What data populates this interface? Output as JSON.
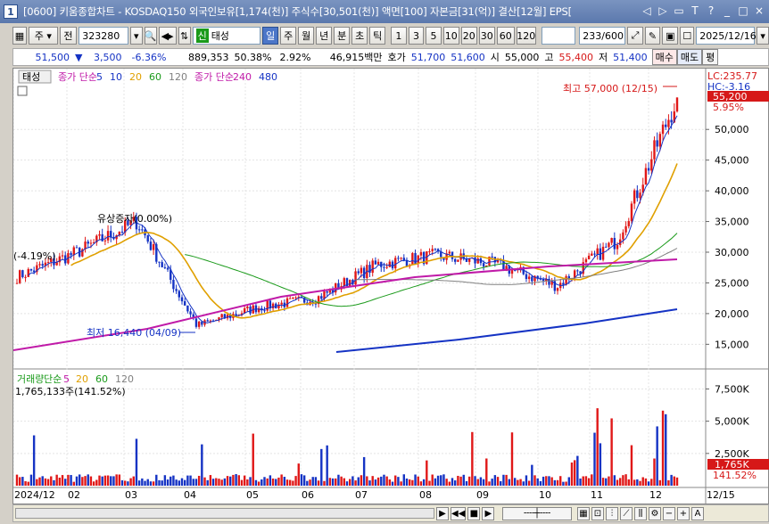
{
  "window": {
    "icon_label": "1",
    "title": "[0600] 키움종합차트 - KOSDAQ150 외국인보유[1,174(천)] 주식수[30,501(천)] 액면[100] 자본금[31(억)] 결산[12월] EPS[",
    "controls": [
      "◁",
      "▷",
      "▭",
      "T",
      "?",
      "_",
      "□",
      "×"
    ]
  },
  "toolbar": {
    "mode": "주",
    "prev_label": "전",
    "code": "323280",
    "stock_badge": "신",
    "stock_name": "태성",
    "periods": [
      "일",
      "주",
      "월",
      "년",
      "분",
      "초",
      "틱"
    ],
    "selected_period": "일",
    "intervals": [
      "1",
      "3",
      "5",
      "10",
      "20",
      "30",
      "60",
      "120"
    ],
    "count": "233",
    "count_total": "/600",
    "date": "2025/12/16"
  },
  "quote": {
    "price": "51,500",
    "change": "3,500",
    "change_pct": "-6.36%",
    "volume": "889,353",
    "vol_ratio": "50.38%",
    "turnover": "2.92%",
    "amount": "46,915백만",
    "ask_label": "호가",
    "ask": "51,700",
    "bid": "51,600",
    "open_label": "시",
    "open": "55,000",
    "high_label": "고",
    "high": "55,400",
    "low_label": "저",
    "low": "51,400",
    "buy_label": "매수",
    "sell_label": "매도",
    "eval_label": "평"
  },
  "price_panel": {
    "tab": "태성",
    "legend": [
      {
        "text": "종가 단순",
        "color": "#c01aa8"
      },
      {
        "text": "5",
        "color": "#1533c4"
      },
      {
        "text": "10",
        "color": "#1533c4"
      },
      {
        "text": "20",
        "color": "#e0a000"
      },
      {
        "text": "60",
        "color": "#1a9a1a"
      },
      {
        "text": "120",
        "color": "#808080"
      },
      {
        "text": "종가 단순",
        "color": "#c01aa8"
      },
      {
        "text": "240",
        "color": "#c01aa8"
      },
      {
        "text": "480",
        "color": "#1533c4"
      }
    ],
    "lc": "LC:235.77",
    "hc": "HC:-3.16",
    "current": "55,200",
    "current_pct": "5.95%",
    "high_note": "최고 57,000 (12/15)",
    "low_note": "최저 16,440 (04/09)",
    "event_note": "유상증자(0.00%)",
    "left_note": "(-4.19%)",
    "yaxis": [
      {
        "label": "50,000",
        "v": 50000
      },
      {
        "label": "45,000",
        "v": 45000
      },
      {
        "label": "40,000",
        "v": 40000
      },
      {
        "label": "35,000",
        "v": 35000
      },
      {
        "label": "30,000",
        "v": 30000
      },
      {
        "label": "25,000",
        "v": 25000
      },
      {
        "label": "20,000",
        "v": 20000
      },
      {
        "label": "15,000",
        "v": 15000
      }
    ]
  },
  "volume_panel": {
    "legend": [
      {
        "text": "거래량",
        "color": "#1a9a1a"
      },
      {
        "text": "단순",
        "color": "#1a9a1a"
      },
      {
        "text": "5",
        "color": "#c01aa8"
      },
      {
        "text": "20",
        "color": "#e0a000"
      },
      {
        "text": "60",
        "color": "#1a9a1a"
      },
      {
        "text": "120",
        "color": "#808080"
      }
    ],
    "max_note": "1,765,133주(141.52%)",
    "current": "1,765K",
    "current_pct": "141.52%",
    "yaxis": [
      {
        "label": "7,500K",
        "v": 7500
      },
      {
        "label": "5,000K",
        "v": 5000
      },
      {
        "label": "2,500K",
        "v": 2500
      }
    ]
  },
  "xaxis": [
    "2024/12",
    "02",
    "03",
    "04",
    "05",
    "06",
    "07",
    "08",
    "09",
    "10",
    "11",
    "12",
    "12/15"
  ],
  "chart_data": {
    "type": "candlestick",
    "x": [
      "2024/12",
      "02",
      "03",
      "04",
      "05",
      "06",
      "07",
      "08",
      "09",
      "10",
      "11",
      "12"
    ],
    "close_approx": [
      26000,
      30000,
      35000,
      18000,
      21000,
      22500,
      28000,
      29500,
      28000,
      24500,
      32000,
      55200
    ],
    "ylim": [
      12000,
      57000
    ],
    "high": 57000,
    "low": 16440
  }
}
